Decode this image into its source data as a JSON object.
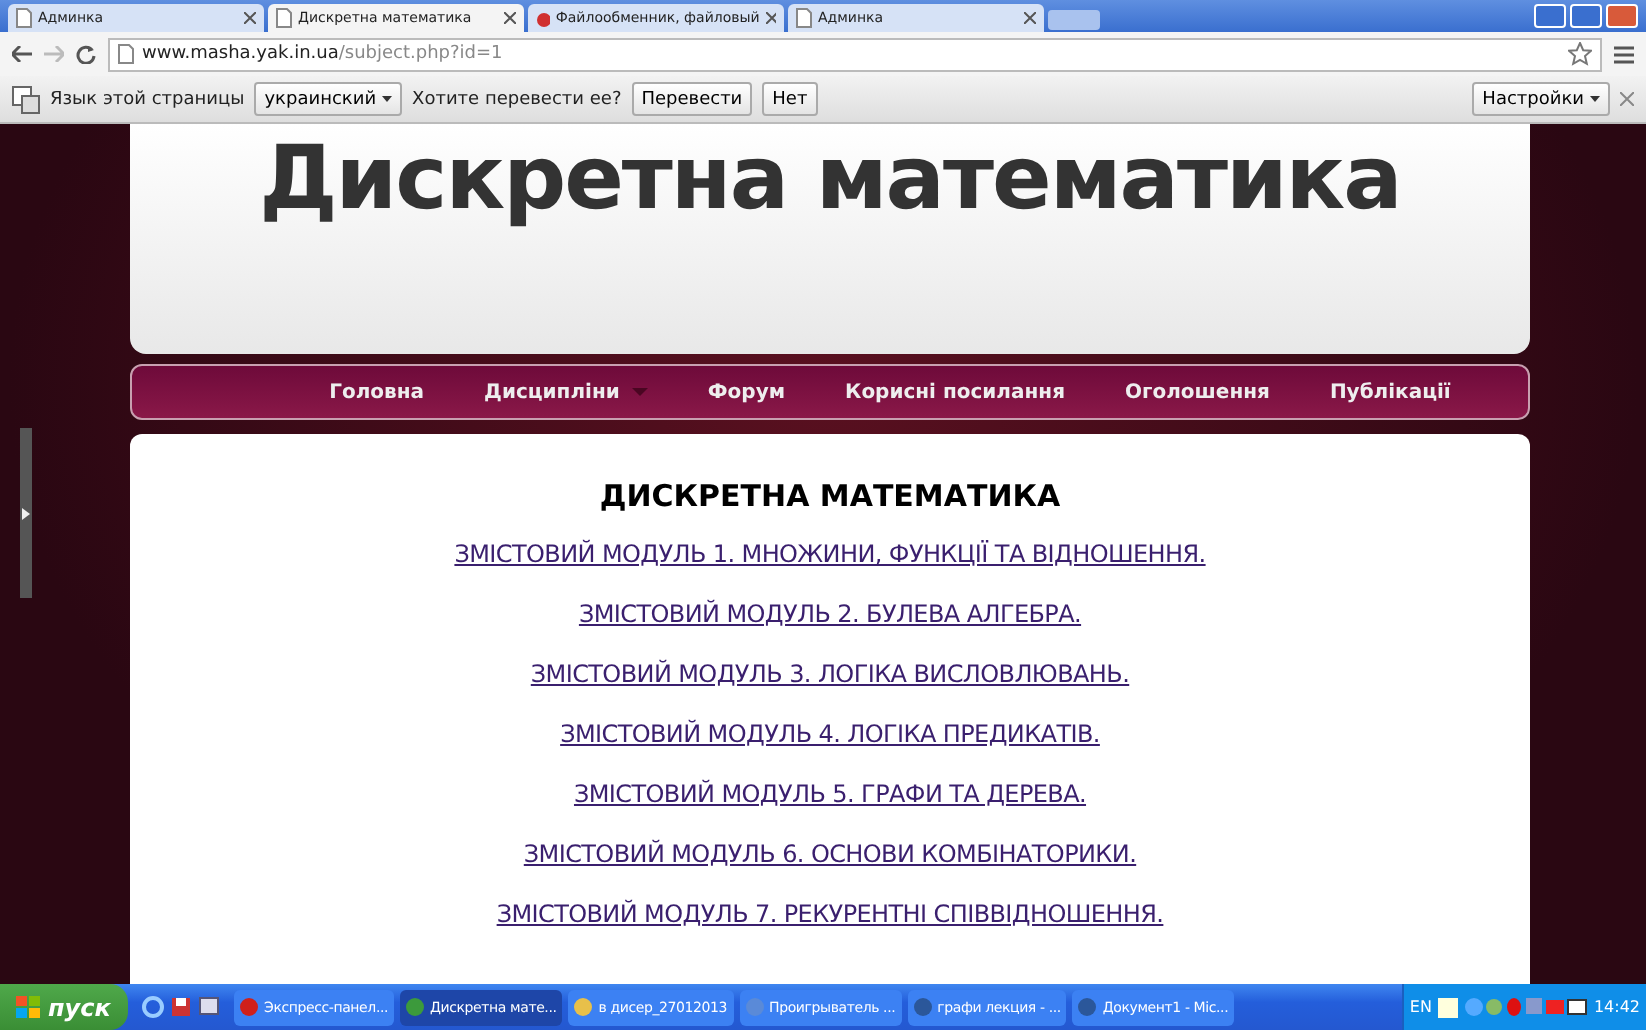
{
  "browser": {
    "tabs": [
      {
        "title": "Админка",
        "selected": false,
        "kind": "page"
      },
      {
        "title": "Дискретна математика",
        "selected": true,
        "kind": "page"
      },
      {
        "title": "Файлообменник, файловый",
        "selected": false,
        "kind": "app"
      },
      {
        "title": "Админка",
        "selected": false,
        "kind": "page"
      }
    ],
    "address": {
      "host": "www.masha.yak.in.ua",
      "path": "/subject.php?id=1"
    }
  },
  "translate_bar": {
    "label": "Язык этой страницы",
    "language": "украинский",
    "question": "Хотите перевести ее?",
    "buttons": [
      "Перевести",
      "Нет"
    ],
    "settings": "Настройки"
  },
  "site": {
    "title": "Дискретна математика",
    "nav": [
      {
        "label": "Головна",
        "has_menu": false
      },
      {
        "label": "Дисципліни",
        "has_menu": true
      },
      {
        "label": "Форум",
        "has_menu": false
      },
      {
        "label": "Корисні посилання",
        "has_menu": false
      },
      {
        "label": "Оголошення",
        "has_menu": false
      },
      {
        "label": "Публікації",
        "has_menu": false
      }
    ],
    "heading": "ДИСКРЕТНА МАТЕМАТИКА",
    "modules": [
      "ЗМІСТОВИЙ МОДУЛЬ 1. МНОЖИНИ, ФУНКЦІЇ ТА ВІДНОШЕННЯ.",
      "ЗМІСТОВИЙ МОДУЛЬ 2. БУЛЕВА АЛГЕБРА.",
      "ЗМІСТОВИЙ МОДУЛЬ 3. ЛОГІКА ВИСЛОВЛЮВАНЬ.",
      "ЗМІСТОВИЙ МОДУЛЬ 4. ЛОГІКА ПРЕДИКАТІВ.",
      "ЗМІСТОВИЙ МОДУЛЬ 5. ГРАФИ ТА ДЕРЕВА.",
      "ЗМІСТОВИЙ МОДУЛЬ 6. ОСНОВИ КОМБІНАТОРИКИ.",
      "ЗМІСТОВИЙ МОДУЛЬ 7. РЕКУРЕНТНІ СПІВВІДНОШЕННЯ."
    ]
  },
  "taskbar": {
    "start": "пуск",
    "items": [
      {
        "label": "Экспресс-панел...",
        "selected": false,
        "color": "#d0201a"
      },
      {
        "label": "Дискретна мате...",
        "selected": true,
        "color": "#3c9a3c"
      },
      {
        "label": "в дисер_27012013",
        "selected": false,
        "color": "#e8c04a"
      },
      {
        "label": "Проигрыватель ...",
        "selected": false,
        "color": "#5a8ad8"
      },
      {
        "label": "графи лекция - ...",
        "selected": false,
        "color": "#2b579a"
      },
      {
        "label": "Документ1 - Mic...",
        "selected": false,
        "color": "#2b579a"
      }
    ],
    "language": "EN",
    "time": "14:42"
  }
}
